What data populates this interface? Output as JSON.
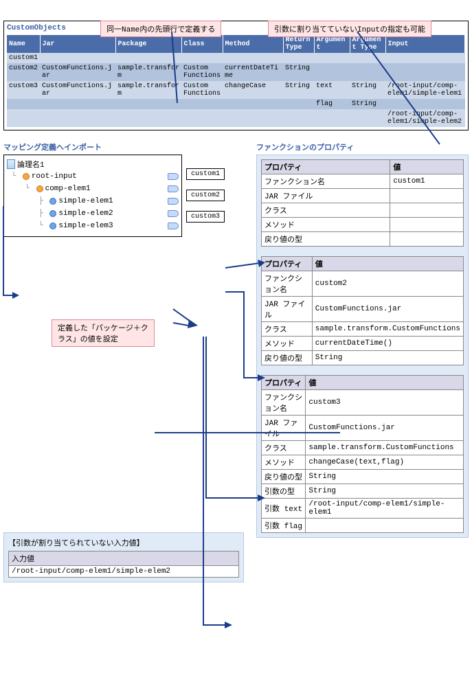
{
  "callouts": {
    "c1": "同一Name内の先頭行で定義する",
    "c2": "引数に割り当てていないInputの指定も可能",
    "c3": "定義した「パッケージ＋クラス」の値を設定"
  },
  "customObjects": {
    "title": "CustomObjects",
    "headers": [
      "Name",
      "Jar",
      "Package",
      "Class",
      "Method",
      "Return Type",
      "Argument",
      "Argument Type",
      "Input"
    ],
    "rows": [
      {
        "name": "custom1",
        "jar": "",
        "package": "",
        "class": "",
        "method": "",
        "rtype": "",
        "arg": "",
        "atype": "",
        "input": ""
      },
      {
        "name": "custom2",
        "jar": "CustomFunctions.jar",
        "package": "sample.transform",
        "class": "Custom Functions",
        "method": "currentDateTime",
        "rtype": "String",
        "arg": "",
        "atype": "",
        "input": ""
      },
      {
        "name": "custom3",
        "jar": "CustomFunctions.jar",
        "package": "sample.transform",
        "class": "Custom Functions",
        "method": "changeCase",
        "rtype": "String",
        "arg": "text",
        "atype": "String",
        "input": "/root-input/comp-elem1/simple-elem1"
      },
      {
        "name": "",
        "jar": "",
        "package": "",
        "class": "",
        "method": "",
        "rtype": "",
        "arg": "flag",
        "atype": "String",
        "input": ""
      },
      {
        "name": "",
        "jar": "",
        "package": "",
        "class": "",
        "method": "",
        "rtype": "",
        "arg": "",
        "atype": "",
        "input": "/root-input/comp-elem1/simple-elem2"
      }
    ]
  },
  "mapping": {
    "title": "マッピング定義へインポート",
    "root": "論理名1",
    "nodes": [
      "root-input",
      "comp-elem1",
      "simple-elem1",
      "simple-elem2",
      "simple-elem3"
    ],
    "buttons": [
      "custom1",
      "custom2",
      "custom3"
    ]
  },
  "funcPropTitle": "ファンクションのプロパティ",
  "propHeaders": {
    "p": "プロパティ",
    "v": "値"
  },
  "propLabels": {
    "fname": "ファンクション名",
    "jar": "JAR ファイル",
    "class": "クラス",
    "method": "メソッド",
    "rtype": "戻り値の型",
    "atype": "引数の型",
    "argtext": "引数 text",
    "argflag": "引数 flag"
  },
  "props1": {
    "fname": "custom1",
    "jar": "",
    "class": "",
    "method": "",
    "rtype": ""
  },
  "props2": {
    "fname": "custom2",
    "jar": "CustomFunctions.jar",
    "class": "sample.transform.CustomFunctions",
    "method": "currentDateTime()",
    "rtype": "String"
  },
  "props3": {
    "fname": "custom3",
    "jar": "CustomFunctions.jar",
    "class": "sample.transform.CustomFunctions",
    "method": "changeCase(text,flag)",
    "rtype": "String",
    "atype": "String",
    "argtext": "/root-input/comp-elem1/simple-elem1",
    "argflag": ""
  },
  "unassigned": {
    "title": "【引数が割り当てられていない入力値】",
    "label": "入力値",
    "value": "/root-input/comp-elem1/simple-elem2"
  }
}
